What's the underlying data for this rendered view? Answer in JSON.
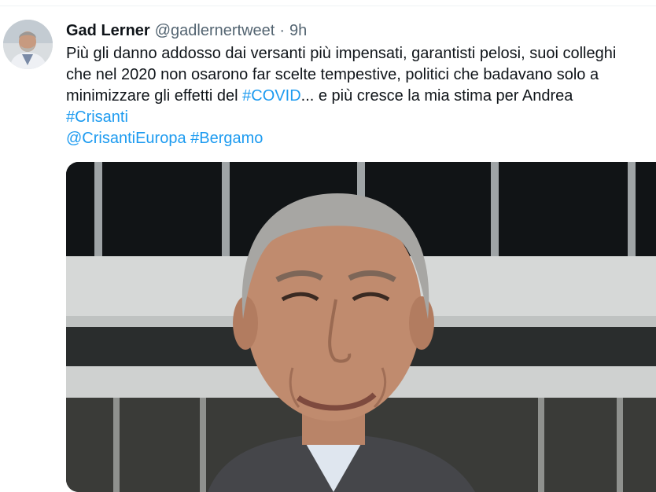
{
  "tweet": {
    "author": {
      "name": "Gad Lerner",
      "handle": "@gadlernertweet",
      "separator": "·",
      "time": "9h"
    },
    "text_lines": {
      "l1": "Più gli danno addosso dai versanti più impensati, garantisti pelosi, suoi colleghi",
      "l2": "che nel 2020 non osarono far scelte tempestive, politici che badavano solo a",
      "l3_prefix": "minimizzare gli effetti del ",
      "l3_hashtag": "#COVID",
      "l3_suffix": "... e più cresce la mia stima per Andrea",
      "l4_hashtag": "#Crisanti",
      "l5_mention": "@CrisantiEuropa",
      "l5_hashtag": "#Bergamo"
    },
    "media": {
      "icon": "photo"
    }
  },
  "colors": {
    "text": "#0f1419",
    "secondary": "#536471",
    "link": "#1d9bf0"
  }
}
